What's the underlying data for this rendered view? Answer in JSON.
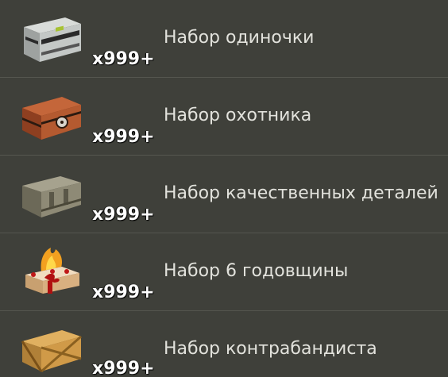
{
  "items": [
    {
      "name": "Набор одиночки",
      "count": "x999+",
      "icon": "steel-crate-icon"
    },
    {
      "name": "Набор охотника",
      "count": "x999+",
      "icon": "wooden-chest-icon"
    },
    {
      "name": "Набор качественных деталей",
      "count": "x999+",
      "icon": "metal-case-icon"
    },
    {
      "name": "Набор 6 годовщины",
      "count": "x999+",
      "icon": "anniversary-gift-icon"
    },
    {
      "name": "Набор контрабандиста",
      "count": "x999+",
      "icon": "wooden-crate-icon"
    }
  ],
  "colors": {
    "background": "#3f403a",
    "divider": "#55564f",
    "text": "#e2e2dc",
    "count": "#ffffff"
  }
}
